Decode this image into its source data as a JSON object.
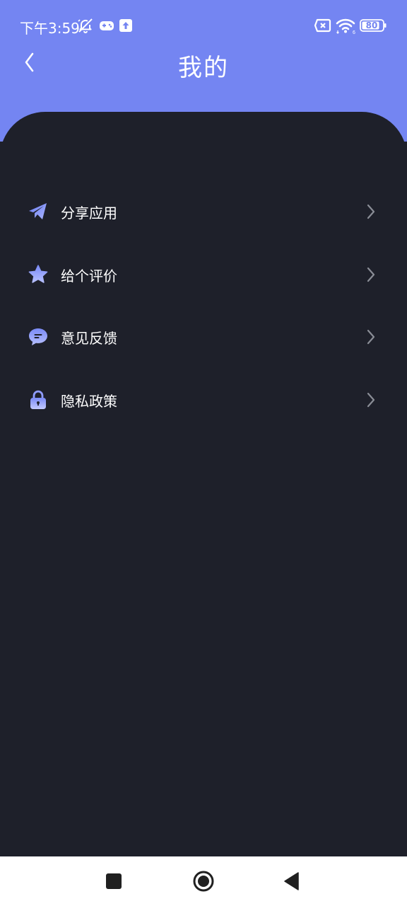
{
  "status_bar": {
    "time": "下午3:59",
    "battery": "80",
    "left_icons": [
      "bell-off-icon",
      "gamepad-icon",
      "upload-icon"
    ],
    "right_icons": [
      "sim-x-icon",
      "wifi-icon",
      "battery-icon"
    ]
  },
  "header": {
    "title": "我的",
    "back_icon": "chevron-left-icon"
  },
  "menu": [
    {
      "label": "分享应用",
      "icon": "paper-plane-icon"
    },
    {
      "label": "给个评价",
      "icon": "star-icon"
    },
    {
      "label": "意见反馈",
      "icon": "chat-bubble-icon"
    },
    {
      "label": "隐私政策",
      "icon": "lock-icon"
    }
  ],
  "nav_bar": {
    "buttons": [
      "recents-square-icon",
      "home-circle-icon",
      "back-triangle-icon"
    ]
  },
  "colors": {
    "header_bg": "#7485f2",
    "content_bg": "#1e202a",
    "icon_accent": "#8f9cff"
  }
}
